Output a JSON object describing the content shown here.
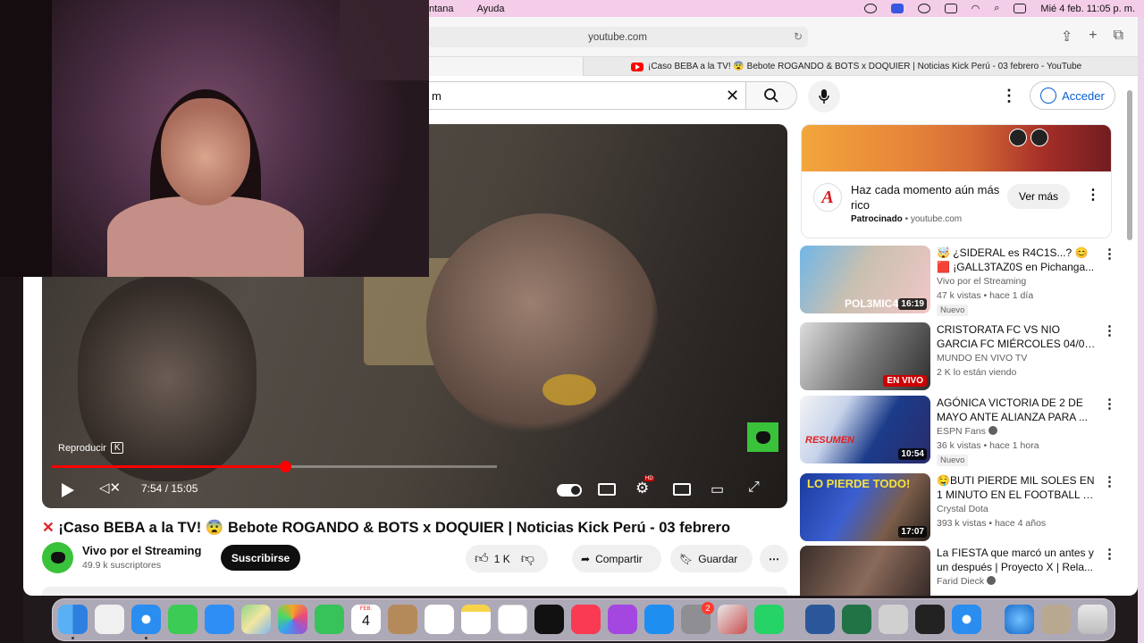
{
  "menubar": {
    "menus": [
      "ntana",
      "Ayuda"
    ],
    "clock": "Mié 4 feb.  11:05 p. m."
  },
  "browser": {
    "url": "youtube.com",
    "tab_title": "¡Caso BEBA a la TV! 😨 Bebote ROGANDO & BOTS x DOQUIER | Noticias Kick Perú - 03 febrero - YouTube"
  },
  "youtube": {
    "search_value": "m",
    "signin_label": "Acceder"
  },
  "player": {
    "tooltip_label": "Reproducir",
    "tooltip_key": "K",
    "time": "7:54 / 15:05",
    "progress_fraction": 0.524,
    "buffer_fraction": 1.0
  },
  "video": {
    "title": "¡Caso BEBA a la TV! 😨 Bebote ROGANDO & BOTS x DOQUIER | Noticias Kick Perú - 03 febrero",
    "channel": "Vivo por el Streaming",
    "subscribers": "49.9 k suscriptores",
    "subscribe_label": "Suscribirse",
    "likes": "1 K",
    "share_label": "Compartir",
    "save_label": "Guardar"
  },
  "ad": {
    "title": "Haz cada momento aún más rico",
    "sponsored": "Patrocinado",
    "domain": "youtube.com",
    "button": "Ver más"
  },
  "recommendations": [
    {
      "title1": "🤯 ¿SIDERAL es R4C1S...? 😊",
      "title2": "🟥 ¡GALL3TAZ0S en Pichanga...",
      "channel": "Vivo por el Streaming",
      "views": "47 k vistas • hace 1 día",
      "badge": "Nuevo",
      "duration": "16:19",
      "thumb_text": "POL3MIC4S"
    },
    {
      "title1": "CRISTORATA FC VS NIO",
      "title2": "GARCIA FC MIÉRCOLES 04/02 ...",
      "channel": "MUNDO EN VIVO TV",
      "views": "2 K lo están viendo",
      "badge": "",
      "duration": "EN VIVO",
      "thumb_text": ""
    },
    {
      "title1": "AGÓNICA VICTORIA DE 2 DE",
      "title2": "MAYO ANTE ALIANZA PARA ...",
      "channel": "ESPN Fans",
      "views": "36 k vistas • hace 1 hora",
      "badge": "Nuevo",
      "duration": "10:54",
      "thumb_text": "RESUMEN"
    },
    {
      "title1": "🤤BUTI PIERDE MIL SOLES EN",
      "title2": "1 MINUTO EN EL FOOTBALL Y ...",
      "channel": "Crystal Dota",
      "views": "393 k vistas • hace 4 años",
      "badge": "",
      "duration": "17:07",
      "thumb_text": "LO PIERDE TODO!"
    },
    {
      "title1": "La FIESTA que marcó un antes y",
      "title2": "un después | Proyecto X | Rela...",
      "channel": "Farid Dieck",
      "views": "",
      "badge": "",
      "duration": "",
      "thumb_text": ""
    }
  ],
  "dock": {
    "calendar_month": "FEB.",
    "calendar_day": "4",
    "settings_badge": "2"
  },
  "colors": {
    "accent_red": "#ff0000",
    "link_blue": "#065fd4",
    "menubar_pink": "#f4cde8"
  }
}
